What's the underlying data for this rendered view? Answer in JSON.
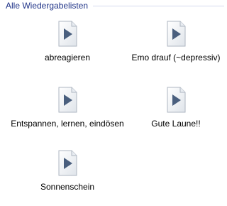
{
  "group": {
    "title": "Alle Wiedergabelisten"
  },
  "playlists": [
    {
      "name": "abreagieren",
      "icon": "playlist-play-icon"
    },
    {
      "name": "Emo drauf (~depressiv)",
      "icon": "playlist-play-icon"
    },
    {
      "name": "Entspannen, lernen, eindösen",
      "icon": "playlist-play-icon"
    },
    {
      "name": "Gute Laune!!",
      "icon": "playlist-play-icon"
    },
    {
      "name": "Sonnenschein",
      "icon": "playlist-play-icon"
    }
  ],
  "colors": {
    "header_text": "#1e3287",
    "header_line": "#d4dbed",
    "icon_page": "#f4f6f9",
    "icon_play": "#4a5f7e"
  }
}
